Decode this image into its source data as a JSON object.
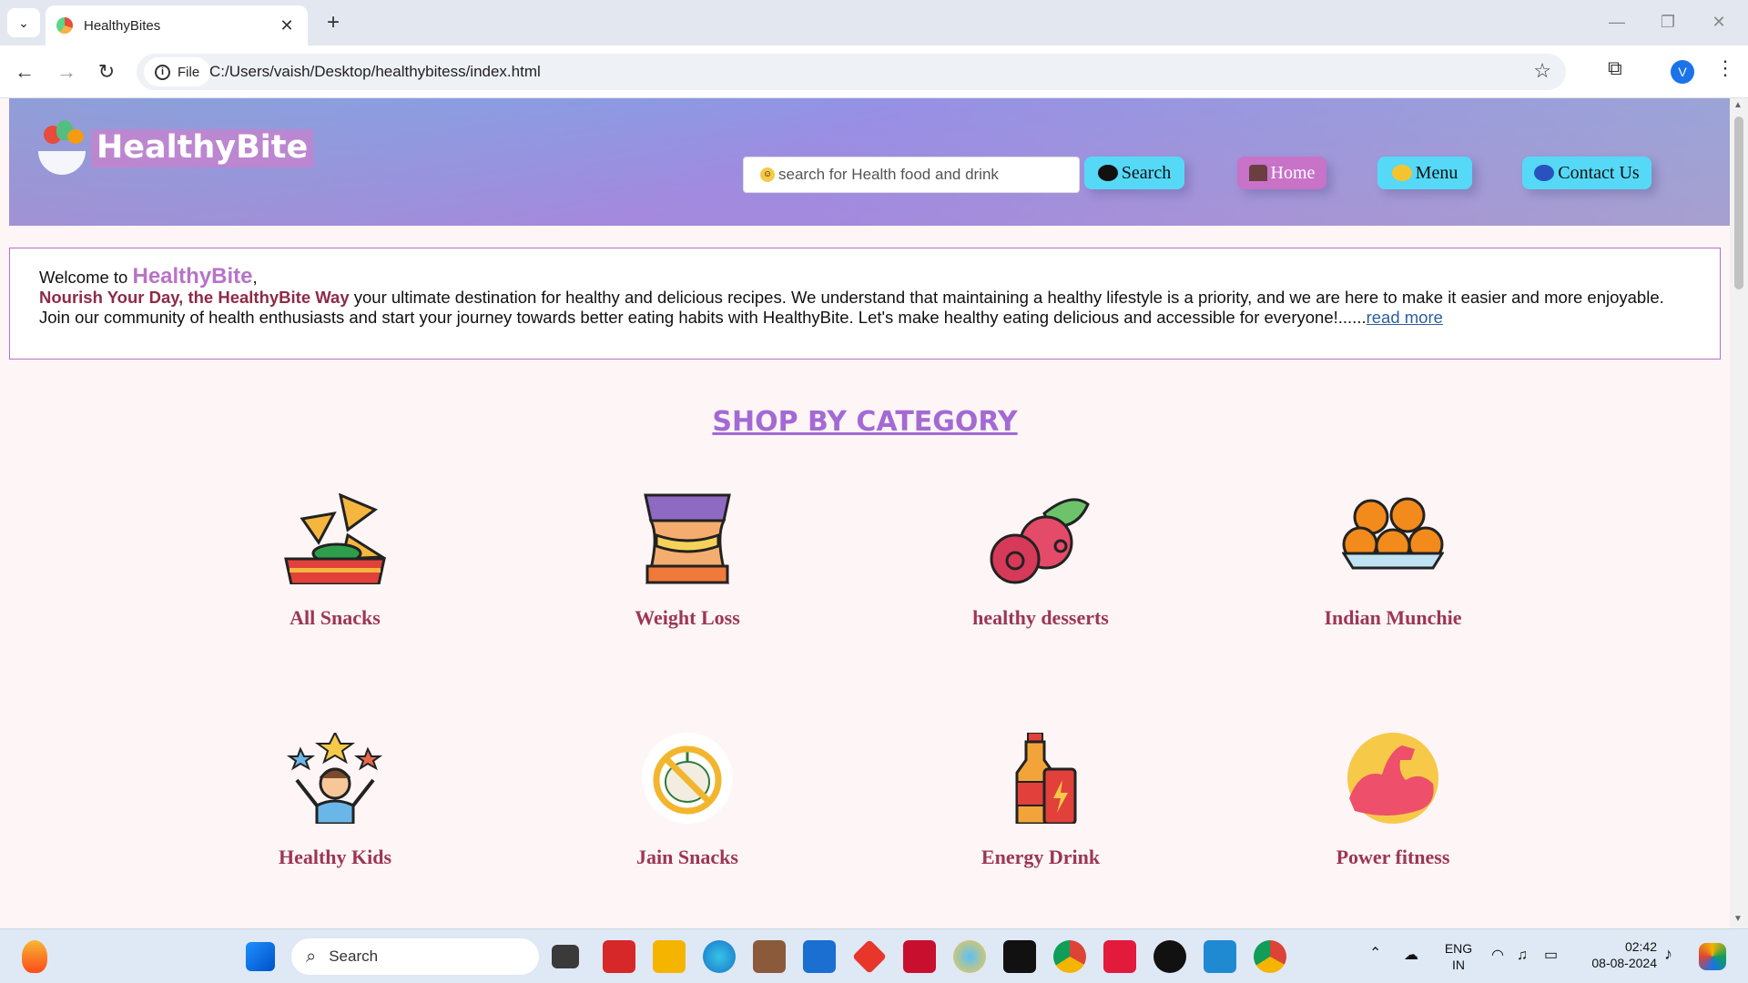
{
  "browser": {
    "tab_title": "HealthyBites",
    "new_tab_symbol": "+",
    "site_chip_label": "File",
    "url": "C:/Users/vaish/Desktop/healthybitess/index.html",
    "profile_initial": "V"
  },
  "site": {
    "logo_text": "HealthyBite",
    "search_placeholder": "search for Health food and drink",
    "search_button": "Search",
    "nav": {
      "home": "Home",
      "menu": "Menu",
      "contact": "Contact Us"
    }
  },
  "welcome": {
    "prefix": "Welcome to ",
    "brand": "HealthyBite",
    "comma": ",",
    "tagline": "Nourish Your Day, the HealthyBite Way",
    "body": " your ultimate destination for healthy and delicious recipes. We understand that maintaining a healthy lifestyle is a priority, and we are here to make it easier and more enjoyable. Join our community of health enthusiasts and start your journey towards better eating habits with HealthyBite. Let's make healthy eating delicious and accessible for everyone!......",
    "read_more": "read more"
  },
  "section_title": "SHOP BY CATEGORY",
  "categories": [
    {
      "label": "All Snacks",
      "icon": "nachos-icon"
    },
    {
      "label": "Weight Loss",
      "icon": "waist-measure-icon"
    },
    {
      "label": "healthy desserts",
      "icon": "berries-icon"
    },
    {
      "label": "Indian Munchie",
      "icon": "ladoo-icon"
    },
    {
      "label": "Healthy Kids",
      "icon": "happy-kid-icon"
    },
    {
      "label": "Jain Snacks",
      "icon": "no-onion-icon"
    },
    {
      "label": "Energy Drink",
      "icon": "energy-drink-icon"
    },
    {
      "label": "Power fitness",
      "icon": "flexed-arm-icon"
    }
  ],
  "taskbar": {
    "search_label": "Search",
    "lang_top": "ENG",
    "lang_bottom": "IN",
    "time": "02:42",
    "date": "08-08-2024"
  }
}
